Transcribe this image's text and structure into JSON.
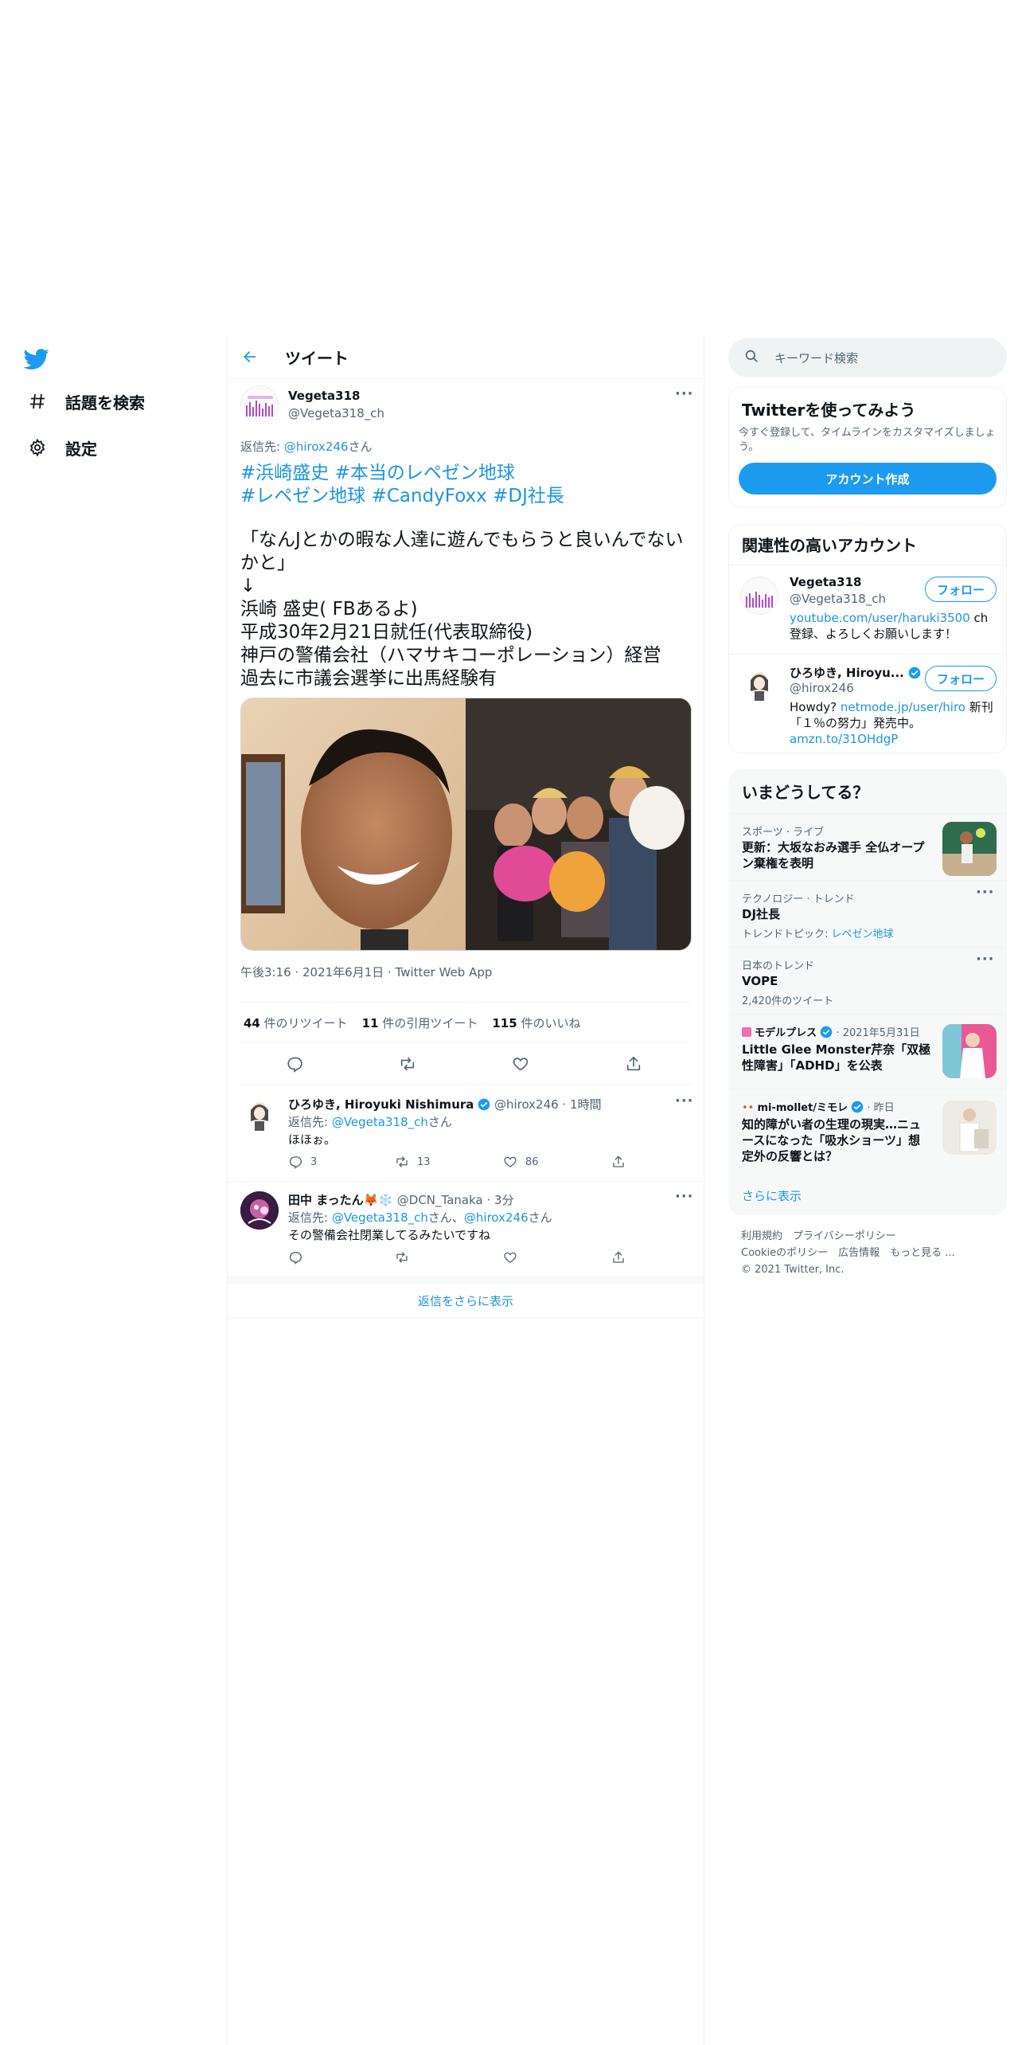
{
  "nav": {
    "items": [
      {
        "label": "話題を検索",
        "icon": "hashtag-icon"
      },
      {
        "label": "設定",
        "icon": "gear-icon"
      }
    ]
  },
  "main": {
    "title": "ツイート",
    "tweet": {
      "author_name": "Vegeta318",
      "author_handle": "@Vegeta318_ch",
      "reply_prefix": "返信先: ",
      "reply_to": "@hirox246",
      "reply_suffix": "さん",
      "hashtags_line1": "#浜崎盛史 #本当のレペゼン地球",
      "hashtags_line2": "#レペゼン地球 #CandyFoxx #DJ社長",
      "text": "「なんJとかの暇な人達に遊んでもらうと良いんでないかと」\n↓\n浜崎 盛史( FBあるよ)\n平成30年2月21日就任(代表取締役)\n神戸の警備会社（ハマサキコーポレーション）経営\n過去に市議会選挙に出馬経験有",
      "timestamp": "午後3:16 · 2021年6月1日 · Twitter Web App",
      "retweets_count": "44",
      "retweets_label": "件のリツイート",
      "quotes_count": "11",
      "quotes_label": "件の引用ツイート",
      "likes_count": "115",
      "likes_label": "件のいいね"
    },
    "replies": [
      {
        "name": "ひろゆき, Hiroyuki Nishimura",
        "handle": "@hirox246",
        "time": "· 1時間",
        "reply_prefix": "返信先: ",
        "reply_to": "@Vegeta318_ch",
        "reply_to2": "",
        "reply_suffix": "さん",
        "text": "ほほぉ。",
        "replies": "3",
        "retweets": "13",
        "likes": "86"
      },
      {
        "name": "田中 まったん🦊❄️",
        "handle": "@DCN_Tanaka",
        "time": "· 3分",
        "reply_prefix": "返信先: ",
        "reply_to": "@Vegeta318_ch",
        "reply_mid": "さん、",
        "reply_to2": "@hirox246",
        "reply_suffix": "さん",
        "text": "その警備会社閉業してるみたいですね",
        "replies": "",
        "retweets": "",
        "likes": ""
      }
    ],
    "show_more": "返信をさらに表示"
  },
  "right": {
    "search_placeholder": "キーワード検索",
    "signup": {
      "title": "Twitterを使ってみよう",
      "desc": "今すぐ登録して、タイムラインをカスタマイズしましょう。",
      "button": "アカウント作成"
    },
    "related": {
      "title": "関連性の高いアカウント",
      "follow_label": "フォロー",
      "accounts": [
        {
          "name": "Vegeta318",
          "handle": "@Vegeta318_ch",
          "bio_link": "youtube.com/user/haruki3500",
          "bio_text": " ch登録、よろしくお願いします！"
        },
        {
          "name": "ひろゆき, Hiroyu...",
          "handle": "@hirox246",
          "bio_pre": "Howdy? ",
          "bio_link": "netmode.jp/user/hiro",
          "bio_text": " 新刊「１％の努力」発売中。",
          "bio_link2": "amzn.to/31OHdgP"
        }
      ]
    },
    "trends": {
      "title": "いまどうしてる？",
      "items": [
        {
          "meta": "スポーツ · ライブ",
          "title": "更新：大坂なおみ選手 全仏オープン棄権を表明"
        },
        {
          "meta": "テクノロジー · トレンド",
          "title": "DJ社長",
          "sub_prefix": "トレンドトピック: ",
          "sub_link": "レペゼン地球"
        },
        {
          "meta": "日本のトレンド",
          "title": "VOPE",
          "sub": "2,420件のツイート"
        },
        {
          "source": "モデルプレス",
          "meta": "· 2021年5月31日",
          "title": "Little Glee Monster芹奈「双極性障害」「ADHD」を公表"
        },
        {
          "source": "mi-mollet/ミモレ",
          "meta": "· 昨日",
          "title": "知的障がい者の生理の現実…ニュースになった「吸水ショーツ」想定外の反響とは？"
        }
      ],
      "show_more": "さらに表示"
    },
    "footer": {
      "line1": "利用規約　プライバシーポリシー",
      "line2": "Cookieのポリシー　広告情報　もっと見る ...",
      "line3": "© 2021 Twitter, Inc."
    }
  },
  "colors": {
    "accent": "#1d9bf0",
    "link": "#1b95e0",
    "text": "#0f1419",
    "secondary": "#536471",
    "border": "#eff3f4"
  }
}
